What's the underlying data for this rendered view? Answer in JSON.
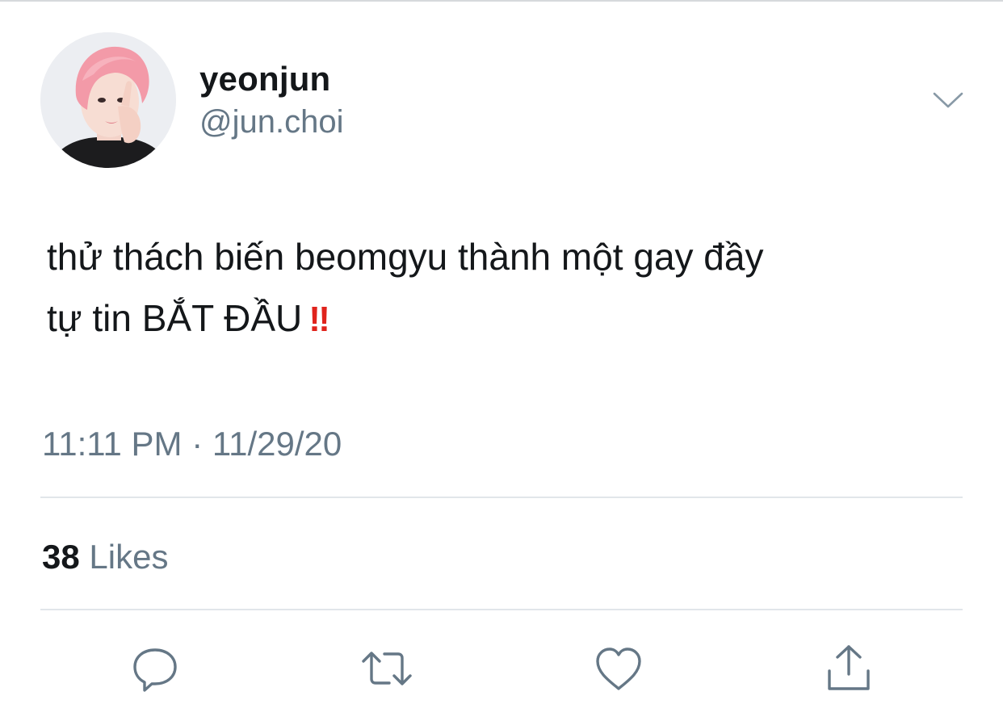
{
  "tweet": {
    "display_name": "yeonjun",
    "handle": "@jun.choi",
    "text_line1": "thử thách biến beomgyu thành một gay đầy",
    "text_line2": "tự tin BẮT ĐẦU",
    "emoji": "‼",
    "timestamp": "11:11 PM · 11/29/20",
    "likes_count": "38",
    "likes_label": "Likes"
  },
  "icons": {
    "more": "chevron-down-icon",
    "reply": "reply-icon",
    "retweet": "retweet-icon",
    "like": "heart-icon",
    "share": "share-icon"
  },
  "colors": {
    "text": "#14171a",
    "secondary": "#657786",
    "divider": "#e1e6ea",
    "emoji_red": "#e0231c",
    "avatar_hair": "#f39aa8"
  }
}
